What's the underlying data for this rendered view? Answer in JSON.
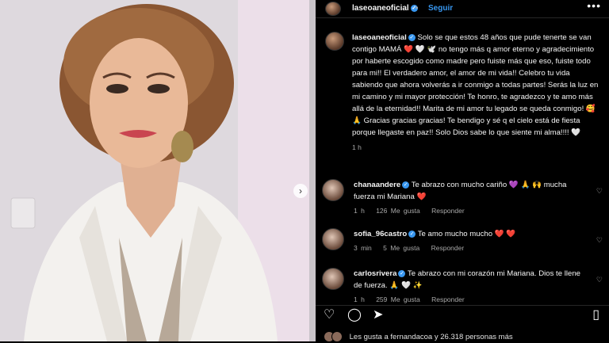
{
  "header": {
    "username": "laseoaneoficial",
    "separator": "•",
    "follow_label": "Seguir",
    "more_icon": "more-horizontal-icon"
  },
  "caption": {
    "username": "laseoaneoficial",
    "text": "Solo se que estos 48 años que pude tenerte se van contigo MAMÁ ❤️ 🤍 🕊️ no tengo más q amor eterno y agradecimiento por haberte escogido como madre pero fuiste más que eso, fuiste todo para mi!! El verdadero amor, el amor de mi vida!! Celebro tu vida sabiendo que ahora volverás a ir conmigo a todas partes! Serás la luz en mi camino y mi mayor protección! Te honro, te agradezco y te amo más allá de la eternidad!! Marita de mi amor tu legado se queda conmigo! 🥰 🙏 Gracias gracias gracias! Te bendigo y sé q el cielo está de fiesta porque llegaste en paz!! Solo Dios sabe lo que siente mi alma!!!! 🤍",
    "time": "1 h"
  },
  "comments": [
    {
      "username": "chanaandere",
      "text": "Te abrazo con mucho cariño 💜 🙏 🙌 mucha fuerza mi Mariana ❤️",
      "time": "1 h",
      "likes": "126 Me gusta",
      "reply": "Responder"
    },
    {
      "username": "sofia_96castro",
      "text": "Te amo mucho mucho ❤️ ❤️",
      "time": "3 min",
      "likes": "5 Me gusta",
      "reply": "Responder"
    },
    {
      "username": "carlosrivera",
      "text": "Te abrazo con mi corazón mi Mariana. Dios te llene de fuerza. 🙏 🤍 ✨",
      "time": "1 h",
      "likes": "259 Me gusta",
      "reply": "Responder"
    }
  ],
  "likes_line": "Les gusta a fernandacoa y 26.318 personas más",
  "icons": {
    "like": "heart-icon",
    "comment": "comment-icon",
    "share": "share-icon",
    "save": "bookmark-icon",
    "carousel_next": "chevron-right-icon"
  },
  "colors": {
    "accent": "#3897f0",
    "background": "#000000",
    "heart": "#ed4956"
  }
}
